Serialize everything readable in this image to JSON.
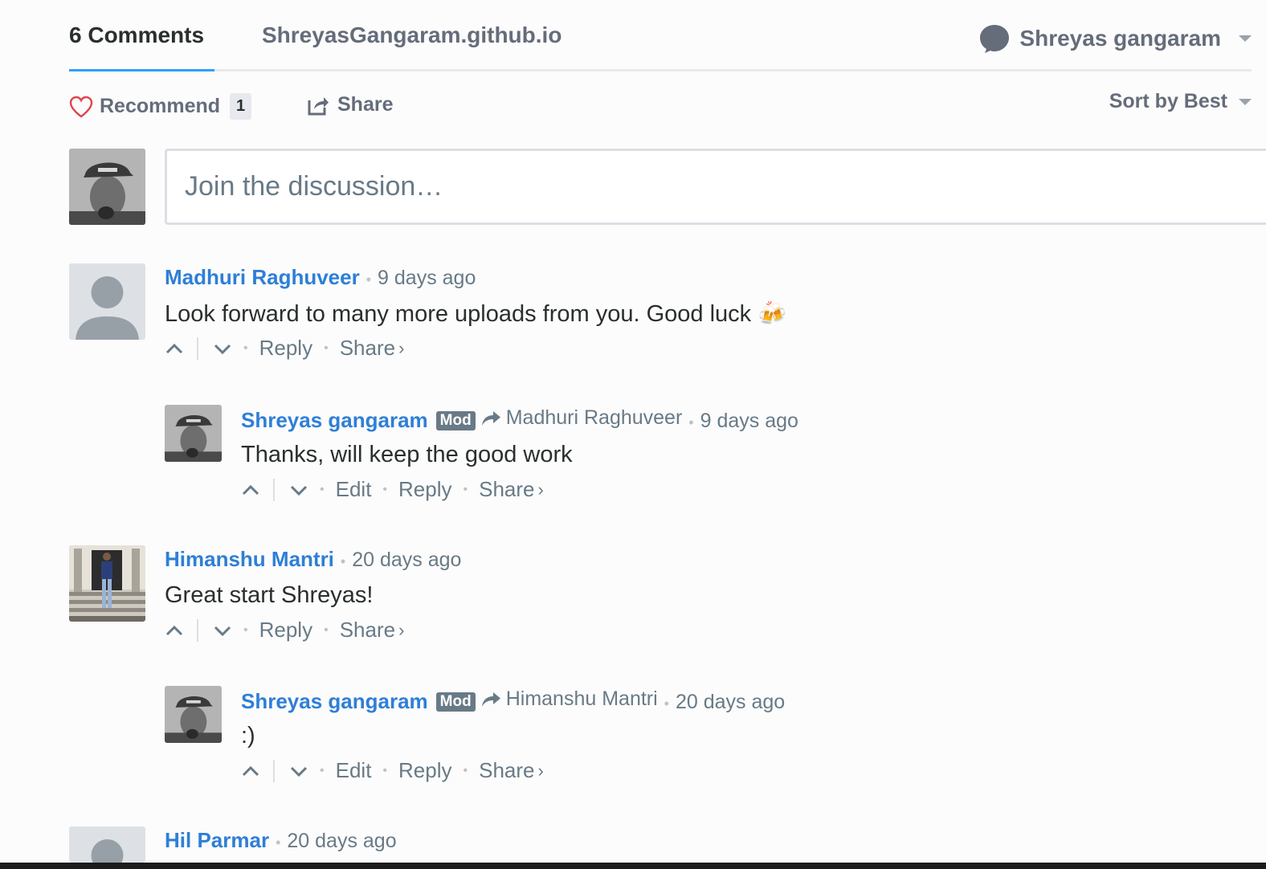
{
  "nav": {
    "comments_tab": "6 Comments",
    "site_tab": "ShreyasGangaram.github.io",
    "user_name": "Shreyas gangaram"
  },
  "actions": {
    "recommend_label": "Recommend",
    "recommend_count": "1",
    "share_label": "Share",
    "sort_label": "Sort by Best"
  },
  "compose": {
    "placeholder": "Join the discussion…"
  },
  "comments": [
    {
      "author": "Madhuri Raghuveer",
      "time": "9 days ago",
      "body": "Look forward to many more uploads from you. Good luck 🍻",
      "reply": "Reply",
      "share": "Share"
    },
    {
      "author": "Shreyas gangaram",
      "badge": "Mod",
      "reply_to": "Madhuri Raghuveer",
      "time": "9 days ago",
      "body": "Thanks, will keep the good work",
      "edit": "Edit",
      "reply": "Reply",
      "share": "Share"
    },
    {
      "author": "Himanshu Mantri",
      "time": "20 days ago",
      "body": "Great start Shreyas!",
      "reply": "Reply",
      "share": "Share"
    },
    {
      "author": "Shreyas gangaram",
      "badge": "Mod",
      "reply_to": "Himanshu Mantri",
      "time": "20 days ago",
      "body": ":)",
      "edit": "Edit",
      "reply": "Reply",
      "share": "Share"
    },
    {
      "author": "Hil Parmar",
      "time": "20 days ago"
    }
  ],
  "symbols": {
    "dot": "•",
    "chevron": "›"
  },
  "colors": {
    "accent": "#2e9fff",
    "author_link": "#2e7fd6",
    "muted": "#687a86",
    "heart": "#e0444f"
  }
}
